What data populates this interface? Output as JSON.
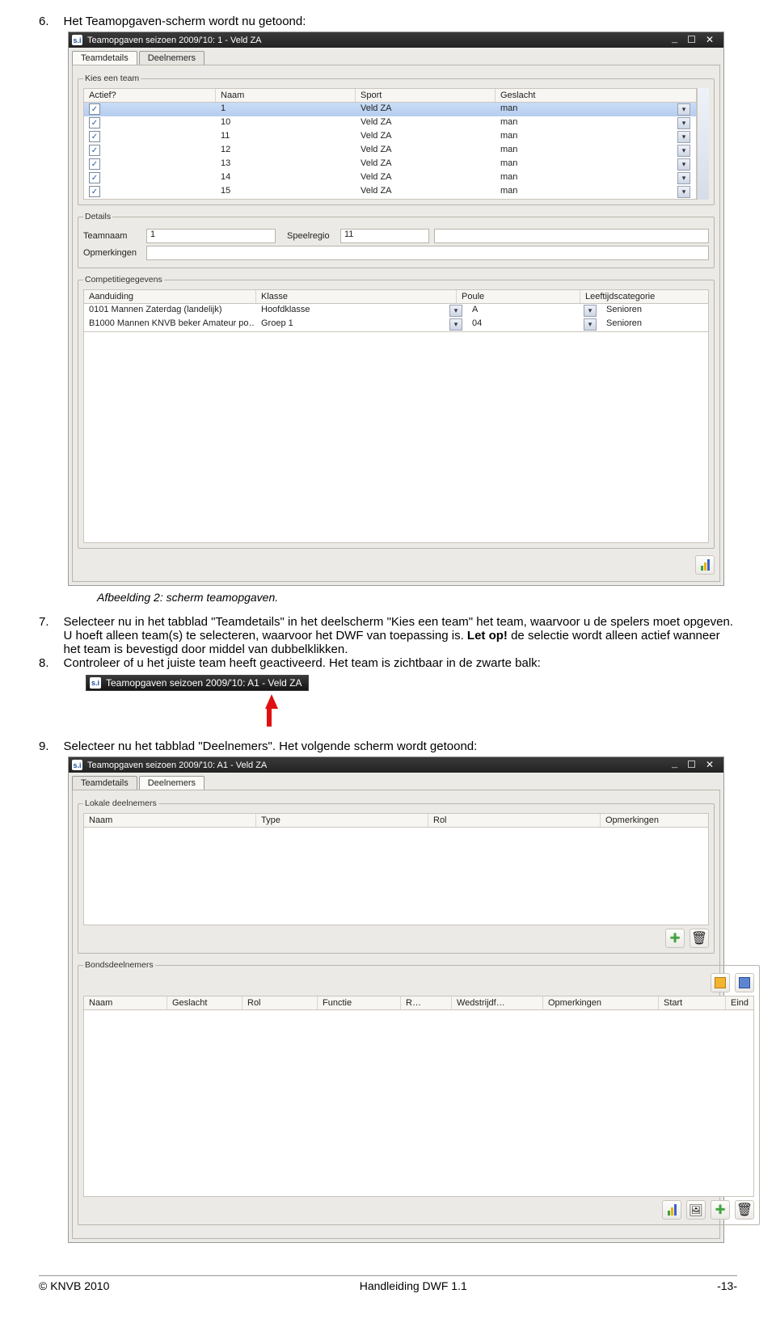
{
  "step6": {
    "num": "6.",
    "text": "Het Teamopgaven-scherm wordt nu getoond:"
  },
  "win1": {
    "title": "Teamopgaven seizoen 2009/'10: 1 - Veld ZA",
    "tabs": {
      "a": "Teamdetails",
      "b": "Deelnemers"
    },
    "grp_kies": "Kies een team",
    "cols": {
      "actief": "Actief?",
      "naam": "Naam",
      "sport": "Sport",
      "geslacht": "Geslacht"
    },
    "rows": [
      {
        "actief": "✓",
        "naam": "1",
        "sport": "Veld ZA",
        "geslacht": "man"
      },
      {
        "actief": "✓",
        "naam": "10",
        "sport": "Veld ZA",
        "geslacht": "man"
      },
      {
        "actief": "✓",
        "naam": "11",
        "sport": "Veld ZA",
        "geslacht": "man"
      },
      {
        "actief": "✓",
        "naam": "12",
        "sport": "Veld ZA",
        "geslacht": "man"
      },
      {
        "actief": "✓",
        "naam": "13",
        "sport": "Veld ZA",
        "geslacht": "man"
      },
      {
        "actief": "✓",
        "naam": "14",
        "sport": "Veld ZA",
        "geslacht": "man"
      },
      {
        "actief": "✓",
        "naam": "15",
        "sport": "Veld ZA",
        "geslacht": "man"
      }
    ],
    "grp_details": "Details",
    "lbl_teamnaam": "Teamnaam",
    "val_teamnaam": "1",
    "lbl_speelregio": "Speelregio",
    "val_speelregio": "11",
    "lbl_opmerk": "Opmerkingen",
    "grp_comp": "Competitiegegevens",
    "comp_cols": {
      "aand": "Aanduiding",
      "klasse": "Klasse",
      "poule": "Poule",
      "leeftijd": "Leeftijdscategorie"
    },
    "comp_rows": [
      {
        "aand": "0101 Mannen Zaterdag (landelijk)",
        "klasse": "Hoofdklasse",
        "poule": "A",
        "leeftijd": "Senioren"
      },
      {
        "aand": "B1000 Mannen KNVB beker Amateur po…",
        "klasse": "Groep 1",
        "poule": "04",
        "leeftijd": "Senioren"
      }
    ]
  },
  "caption": "Afbeelding 2: scherm teamopgaven.",
  "step7": {
    "num": "7.",
    "a": "Selecteer nu in het tabblad \"Teamdetails\" in het deelscherm \"Kies een team\" het team, waarvoor u de spelers moet opgeven. U hoeft alleen team(s) te selecteren, waarvoor het DWF van toepassing is. ",
    "b": "Let op!",
    "c": " de selectie wordt alleen actief wanneer het team is bevestigd door middel van dubbelklikken."
  },
  "step8": {
    "num": "8.",
    "text": "Controleer of u het juiste team heeft geactiveerd. Het team is zichtbaar in de zwarte balk:"
  },
  "blacktitle": "Teamopgaven seizoen 2009/'10: A1 - Veld ZA",
  "step9": {
    "num": "9.",
    "text": "Selecteer nu het tabblad \"Deelnemers\". Het volgende scherm wordt getoond:"
  },
  "win2": {
    "title": "Teamopgaven seizoen 2009/'10: A1 - Veld ZA",
    "tabs": {
      "a": "Teamdetails",
      "b": "Deelnemers"
    },
    "grp_lokale": "Lokale deelnemers",
    "lok_cols": {
      "naam": "Naam",
      "type": "Type",
      "rol": "Rol",
      "opm": "Opmerkingen"
    },
    "grp_bonds": "Bondsdeelnemers",
    "bonds_cols": {
      "naam": "Naam",
      "geslacht": "Geslacht",
      "rol": "Rol",
      "functie": "Functie",
      "r": "R…",
      "wed": "Wedstrijdf…",
      "opm": "Opmerkingen",
      "start": "Start",
      "eind": "Eind"
    }
  },
  "footer": {
    "left": "© KNVB 2010",
    "center": "Handleiding DWF 1.1",
    "right": "-13-"
  }
}
